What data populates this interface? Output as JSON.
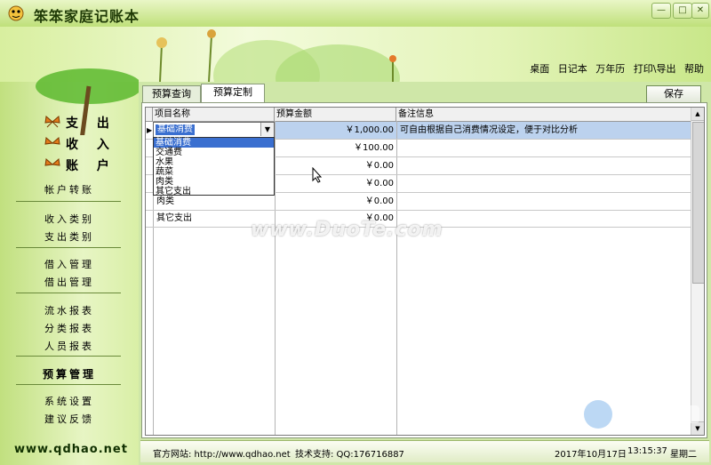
{
  "app": {
    "title": "笨笨家庭记账本"
  },
  "topnav": [
    "桌面",
    "日记本",
    "万年历",
    "打印\\导出",
    "帮助"
  ],
  "sidebar": {
    "main": [
      "支 出",
      "收 入",
      "账 户"
    ],
    "groups": [
      [
        "帐户转账"
      ],
      [
        "收入类别",
        "支出类别"
      ],
      [
        "借入管理",
        "借出管理"
      ],
      [
        "流水报表",
        "分类报表",
        "人员报表"
      ],
      [
        "预算管理"
      ],
      [
        "系统设置",
        "建议反馈"
      ]
    ],
    "site": "www.qdhao.net"
  },
  "tabs": [
    {
      "label": "预算查询"
    },
    {
      "label": "预算定制"
    }
  ],
  "toolbar": {
    "save_label": "保存"
  },
  "grid": {
    "headers": [
      "项目名称",
      "预算金额",
      "备注信息"
    ],
    "rows": [
      {
        "name": "基础消费",
        "amount": "￥1,000.00",
        "note": "可自由根据自己消费情况设定，便于对比分析"
      },
      {
        "name": "",
        "amount": "￥100.00",
        "note": ""
      },
      {
        "name": "",
        "amount": "￥0.00",
        "note": ""
      },
      {
        "name": "",
        "amount": "￥0.00",
        "note": ""
      },
      {
        "name": "肉类",
        "amount": "￥0.00",
        "note": ""
      },
      {
        "name": "其它支出",
        "amount": "￥0.00",
        "note": ""
      }
    ]
  },
  "combo": {
    "value": "基础消费",
    "options": [
      "基础消费",
      "交通费",
      "水果",
      "蔬菜",
      "肉类",
      "其它支出"
    ]
  },
  "watermark": "www.DuoTe.com",
  "statusbar": {
    "website": "官方网站: http://www.qdhao.net",
    "support": "技术支持: QQ:176716887",
    "date": "2017年10月17日",
    "time": "13:15:37",
    "weekday": "星期二"
  },
  "colors": {
    "accent": "#9cc45a",
    "selection": "#3a6fd0"
  }
}
